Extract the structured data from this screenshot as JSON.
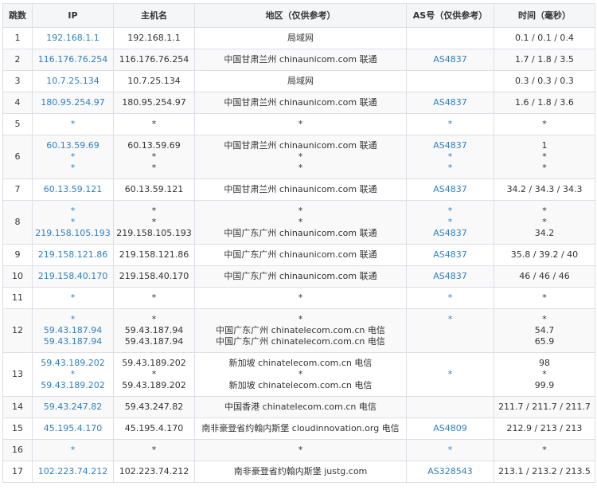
{
  "headers": {
    "hop": "跳数",
    "ip": "IP",
    "host": "主机名",
    "region": "地区（仅供参考）",
    "as": "AS号（仅供参考）",
    "time": "时间（毫秒）"
  },
  "rows": [
    {
      "hop": "1",
      "ip": [
        "192.168.1.1"
      ],
      "host": [
        "192.168.1.1"
      ],
      "region": [
        "局域网"
      ],
      "as": [
        ""
      ],
      "time": [
        "0.1 / 0.1 / 0.4"
      ]
    },
    {
      "hop": "2",
      "ip": [
        "116.176.76.254"
      ],
      "host": [
        "116.176.76.254"
      ],
      "region": [
        "中国甘肃兰州 chinaunicom.com 联通"
      ],
      "as": [
        "AS4837"
      ],
      "time": [
        "1.7 / 1.8 / 3.5"
      ]
    },
    {
      "hop": "3",
      "ip": [
        "10.7.25.134"
      ],
      "host": [
        "10.7.25.134"
      ],
      "region": [
        "局域网"
      ],
      "as": [
        ""
      ],
      "time": [
        "0.3 / 0.3 / 0.3"
      ]
    },
    {
      "hop": "4",
      "ip": [
        "180.95.254.97"
      ],
      "host": [
        "180.95.254.97"
      ],
      "region": [
        "中国甘肃兰州 chinaunicom.com 联通"
      ],
      "as": [
        "AS4837"
      ],
      "time": [
        "1.6 / 1.8 / 3.6"
      ]
    },
    {
      "hop": "5",
      "ip": [
        "*"
      ],
      "host": [
        "*"
      ],
      "region": [
        "*"
      ],
      "as": [
        "*"
      ],
      "time": [
        "*"
      ]
    },
    {
      "hop": "6",
      "ip": [
        "60.13.59.69",
        "*",
        "*"
      ],
      "host": [
        "60.13.59.69",
        "*",
        "*"
      ],
      "region": [
        "中国甘肃兰州 chinaunicom.com 联通",
        "*",
        "*"
      ],
      "as": [
        "AS4837",
        "*",
        "*"
      ],
      "time": [
        "1",
        "*",
        "*"
      ]
    },
    {
      "hop": "7",
      "ip": [
        "60.13.59.121"
      ],
      "host": [
        "60.13.59.121"
      ],
      "region": [
        "中国甘肃兰州 chinaunicom.com 联通"
      ],
      "as": [
        "AS4837"
      ],
      "time": [
        "34.2 / 34.3 / 34.3"
      ]
    },
    {
      "hop": "8",
      "ip": [
        "*",
        "*",
        "219.158.105.193"
      ],
      "host": [
        "*",
        "*",
        "219.158.105.193"
      ],
      "region": [
        "*",
        "*",
        "中国广东广州 chinaunicom.com 联通"
      ],
      "as": [
        "*",
        "*",
        "AS4837"
      ],
      "time": [
        "*",
        "*",
        "34.2"
      ]
    },
    {
      "hop": "9",
      "ip": [
        "219.158.121.86"
      ],
      "host": [
        "219.158.121.86"
      ],
      "region": [
        "中国广东广州 chinaunicom.com 联通"
      ],
      "as": [
        "AS4837"
      ],
      "time": [
        "35.8 / 39.2 / 40"
      ]
    },
    {
      "hop": "10",
      "ip": [
        "219.158.40.170"
      ],
      "host": [
        "219.158.40.170"
      ],
      "region": [
        "中国广东广州 chinaunicom.com 联通"
      ],
      "as": [
        "AS4837"
      ],
      "time": [
        "46 / 46 / 46"
      ]
    },
    {
      "hop": "11",
      "ip": [
        "*"
      ],
      "host": [
        "*"
      ],
      "region": [
        "*"
      ],
      "as": [
        "*"
      ],
      "time": [
        "*"
      ]
    },
    {
      "hop": "12",
      "ip": [
        "*",
        "59.43.187.94",
        "59.43.187.94"
      ],
      "host": [
        "*",
        "59.43.187.94",
        "59.43.187.94"
      ],
      "region": [
        "*",
        "中国广东广州 chinatelecom.com.cn 电信",
        "中国广东广州 chinatelecom.com.cn 电信"
      ],
      "as": [
        "*",
        "",
        ""
      ],
      "time": [
        "*",
        "54.7",
        "65.9"
      ]
    },
    {
      "hop": "13",
      "ip": [
        "59.43.189.202",
        "*",
        "59.43.189.202"
      ],
      "host": [
        "59.43.189.202",
        "*",
        "59.43.189.202"
      ],
      "region": [
        "新加坡 chinatelecom.com.cn 电信",
        "*",
        "新加坡 chinatelecom.com.cn 电信"
      ],
      "as": [
        "",
        "*",
        ""
      ],
      "time": [
        "98",
        "*",
        "99.9"
      ]
    },
    {
      "hop": "14",
      "ip": [
        "59.43.247.82"
      ],
      "host": [
        "59.43.247.82"
      ],
      "region": [
        "中国香港 chinatelecom.com.cn 电信"
      ],
      "as": [
        ""
      ],
      "time": [
        "211.7 / 211.7 / 211.7"
      ]
    },
    {
      "hop": "15",
      "ip": [
        "45.195.4.170"
      ],
      "host": [
        "45.195.4.170"
      ],
      "region": [
        "南非豪登省约翰内斯堡 cloudinnovation.org 电信"
      ],
      "as": [
        "AS4809"
      ],
      "time": [
        "212.9 / 213 / 213"
      ]
    },
    {
      "hop": "16",
      "ip": [
        "*"
      ],
      "host": [
        "*"
      ],
      "region": [
        "*"
      ],
      "as": [
        "*"
      ],
      "time": [
        "*"
      ]
    },
    {
      "hop": "17",
      "ip": [
        "102.223.74.212"
      ],
      "host": [
        "102.223.74.212"
      ],
      "region": [
        "南非豪登省约翰内斯堡 justg.com"
      ],
      "as": [
        "AS328543"
      ],
      "time": [
        "213.1 / 213.2 / 213.5"
      ]
    }
  ]
}
